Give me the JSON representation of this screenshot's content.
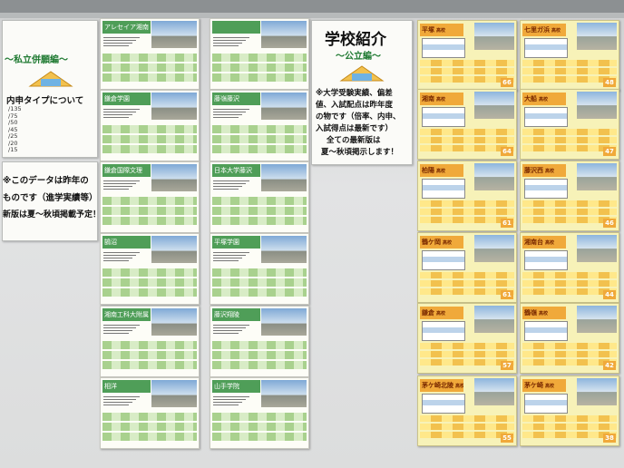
{
  "scene": {
    "description_kind": "photo-of-bulletin-board"
  },
  "left_poster": {
    "heading": "～私立併願編～",
    "subheading": "内申タイプについて",
    "types": [
      "/135",
      "/75",
      "/50",
      "/45",
      "/25",
      "/20",
      "/15"
    ]
  },
  "left_note": {
    "line1": "※このデータは昨年の",
    "line2": "ものです（進学実績等）",
    "line3": "新版は夏～秋頃掲載予定！"
  },
  "center_poster": {
    "title": "学校紹介",
    "subtitle": "～公立編～",
    "body": [
      "※大学受験実績、偏差",
      "値、入試配点は昨年度",
      "の物です（倍率、内申、",
      "入試得点は最新です）",
      "全ての最新版は",
      "夏～秋頃掲示します！"
    ]
  },
  "private_sheets": [
    {
      "name": "アレセイア湘南"
    },
    {
      "name": "鎌倉学園"
    },
    {
      "name": "鎌倉国際文理"
    },
    {
      "name": "鵠沼"
    },
    {
      "name": "湘南工科大附属"
    },
    {
      "name": "相洋"
    },
    {
      "name": ""
    },
    {
      "name": "藤嶺藤沢"
    },
    {
      "name": "日本大学藤沢"
    },
    {
      "name": "平塚学園"
    },
    {
      "name": "藤沢翔陵"
    },
    {
      "name": "山手学院"
    }
  ],
  "public_sheets": [
    {
      "name": "平塚",
      "tag": "高校",
      "num": "66"
    },
    {
      "name": "湘南",
      "tag": "高校",
      "num": "64"
    },
    {
      "name": "柏陽",
      "tag": "高校",
      "num": "61"
    },
    {
      "name": "鶴ケ岡",
      "tag": "高校",
      "num": "61"
    },
    {
      "name": "鎌倉",
      "tag": "高校",
      "num": "57"
    },
    {
      "name": "茅ケ崎北陵",
      "tag": "高校",
      "num": "55"
    },
    {
      "name": "七里ガ浜",
      "tag": "高校",
      "num": "48"
    },
    {
      "name": "大船",
      "tag": "高校",
      "num": "47"
    },
    {
      "name": "藤沢西",
      "tag": "高校",
      "num": "46"
    },
    {
      "name": "湘南台",
      "tag": "高校",
      "num": "44"
    },
    {
      "name": "鶴嶺",
      "tag": "高校",
      "num": "42"
    },
    {
      "name": "茅ケ崎",
      "tag": "高校",
      "num": "38"
    }
  ]
}
